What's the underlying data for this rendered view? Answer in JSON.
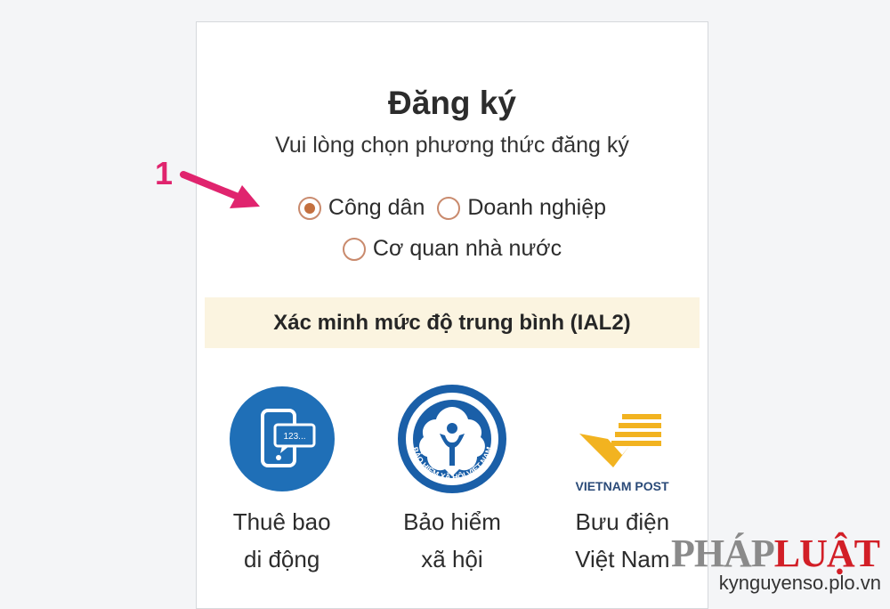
{
  "page": {
    "title": "Đăng ký",
    "subtitle": "Vui lòng chọn phương thức đăng ký"
  },
  "registration_type": {
    "options": [
      {
        "label": "Công dân",
        "selected": true
      },
      {
        "label": "Doanh nghiệp",
        "selected": false
      },
      {
        "label": "Cơ quan nhà nước",
        "selected": false
      }
    ]
  },
  "verification": {
    "banner": "Xác minh mức độ trung bình (IAL2)",
    "methods": [
      {
        "line1": "Thuê bao",
        "line2": "di động",
        "icon": "mobile-phone-icon",
        "logo_text": "123..."
      },
      {
        "line1": "Bảo hiểm",
        "line2": "xã hội",
        "icon": "social-insurance-logo",
        "logo_text": "BẢO HIỂM XÃ HỘI VIỆT NAM"
      },
      {
        "line1": "Bưu điện",
        "line2": "Việt Nam",
        "icon": "vietnam-post-logo",
        "logo_text": "VIETNAM POST"
      }
    ]
  },
  "annotation": {
    "number": "1"
  },
  "watermark": {
    "brand_a": "PHÁP",
    "brand_b": "LUẬT",
    "url": "kynguyenso.plo.vn"
  },
  "colors": {
    "accent_radio": "#c4703f",
    "banner_bg": "#fbf4e0",
    "icon_blue": "#1f6fb7",
    "post_yellow": "#f2b320",
    "annotation_pink": "#e0246e"
  }
}
